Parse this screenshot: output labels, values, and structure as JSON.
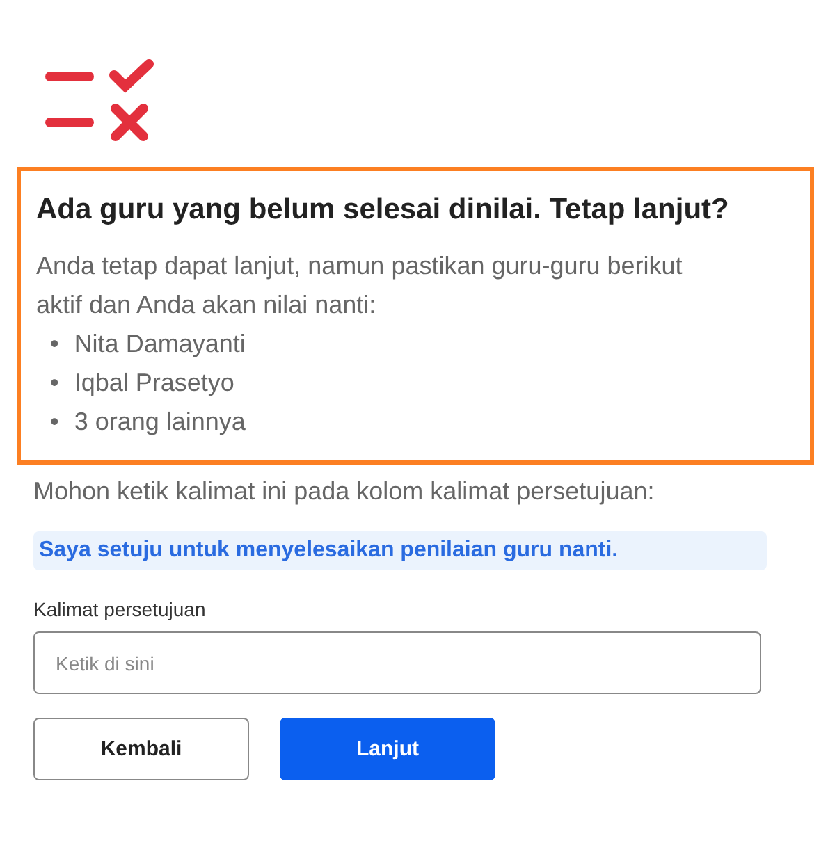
{
  "dialog": {
    "title": "Ada guru yang belum selesai dinilai. Tetap lanjut?",
    "message": "Anda tetap dapat lanjut, namun pastikan guru-guru berikut aktif dan Anda akan nilai nanti:",
    "pending_teachers": [
      {
        "bullet": "•",
        "name": "Nita Damayanti"
      },
      {
        "bullet": "•",
        "name": "Iqbal Prasetyo"
      },
      {
        "bullet": "•",
        "name": "3 orang lainnya"
      }
    ],
    "highlighted": true
  },
  "instruction": "Mohon ketik kalimat ini pada kolom kalimat persetujuan:",
  "consent_sentence": "Saya setuju untuk menyelesaikan penilaian guru nanti.",
  "consent_field": {
    "label": "Kalimat persetujuan",
    "placeholder": "Ketik di sini"
  },
  "buttons": [
    {
      "kind": "secondary",
      "label": "Kembali"
    },
    {
      "kind": "primary",
      "label": "Lanjut"
    }
  ]
}
